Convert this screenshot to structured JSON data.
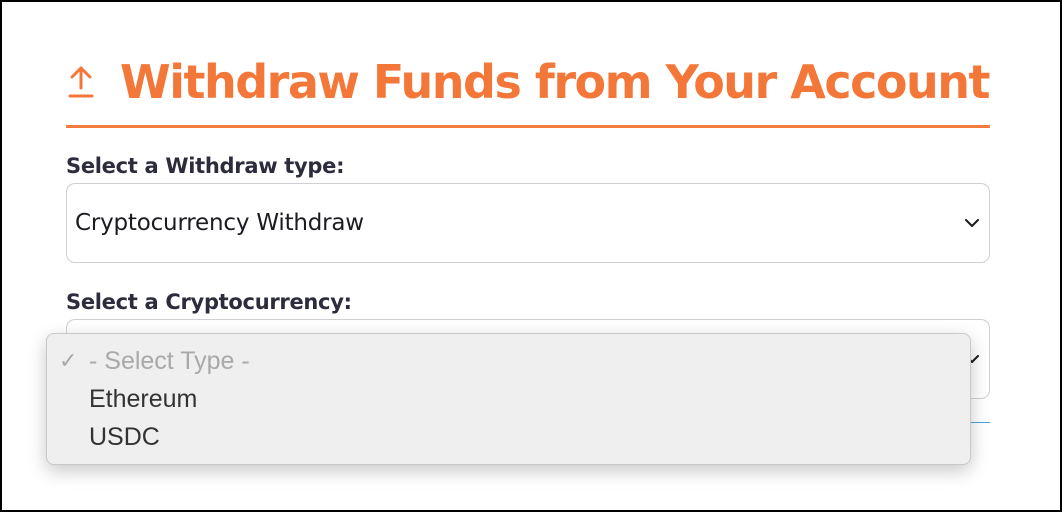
{
  "header": {
    "icon": "upload-icon",
    "title": "Withdraw Funds from Your Account",
    "accent_color": "#f4773a"
  },
  "withdraw_type": {
    "label": "Select a Withdraw type:",
    "selected": "Cryptocurrency Withdraw"
  },
  "cryptocurrency": {
    "label": "Select a Cryptocurrency:",
    "options": [
      {
        "label": "- Select Type -",
        "checked": true,
        "disabled": true
      },
      {
        "label": "Ethereum"
      },
      {
        "label": "USDC"
      }
    ]
  }
}
